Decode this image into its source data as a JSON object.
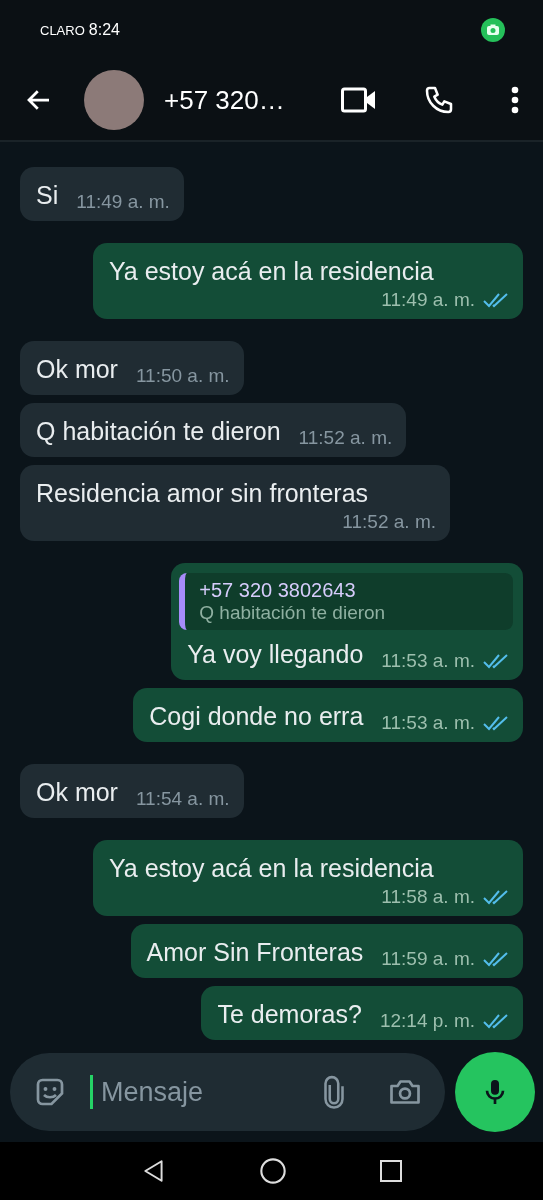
{
  "status_bar": {
    "carrier": "CLARO",
    "time": "8:24"
  },
  "header": {
    "title": "+57 320…"
  },
  "messages": [
    {
      "kind": "in",
      "text": "Si",
      "time": "11:49 a. m."
    },
    {
      "kind": "out",
      "text": "Ya estoy acá en la residencia",
      "time": "11:49 a. m.",
      "read": true
    },
    {
      "kind": "in",
      "text": "Ok mor",
      "time": "11:50 a. m."
    },
    {
      "kind": "in",
      "text": "Q habitación te dieron",
      "time": "11:52 a. m."
    },
    {
      "kind": "in",
      "text": "Residencia amor sin fronteras",
      "time": "11:52 a. m."
    },
    {
      "kind": "out",
      "quote": {
        "author": "+57 320 3802643",
        "text": "Q habitación te dieron"
      },
      "text": "Ya voy llegando",
      "time": "11:53 a. m.",
      "read": true
    },
    {
      "kind": "out",
      "text": "Cogi donde no erra",
      "time": "11:53 a. m.",
      "read": true
    },
    {
      "kind": "in",
      "text": "Ok mor",
      "time": "11:54 a. m."
    },
    {
      "kind": "out",
      "text": "Ya estoy acá en la residencia",
      "time": "11:58 a. m.",
      "read": true
    },
    {
      "kind": "out",
      "text": "Amor Sin Fronteras",
      "time": "11:59 a. m.",
      "read": true
    },
    {
      "kind": "out",
      "text": "Te demoras?",
      "time": "12:14 p. m.",
      "read": true
    }
  ],
  "composer": {
    "placeholder": "Mensaje"
  }
}
